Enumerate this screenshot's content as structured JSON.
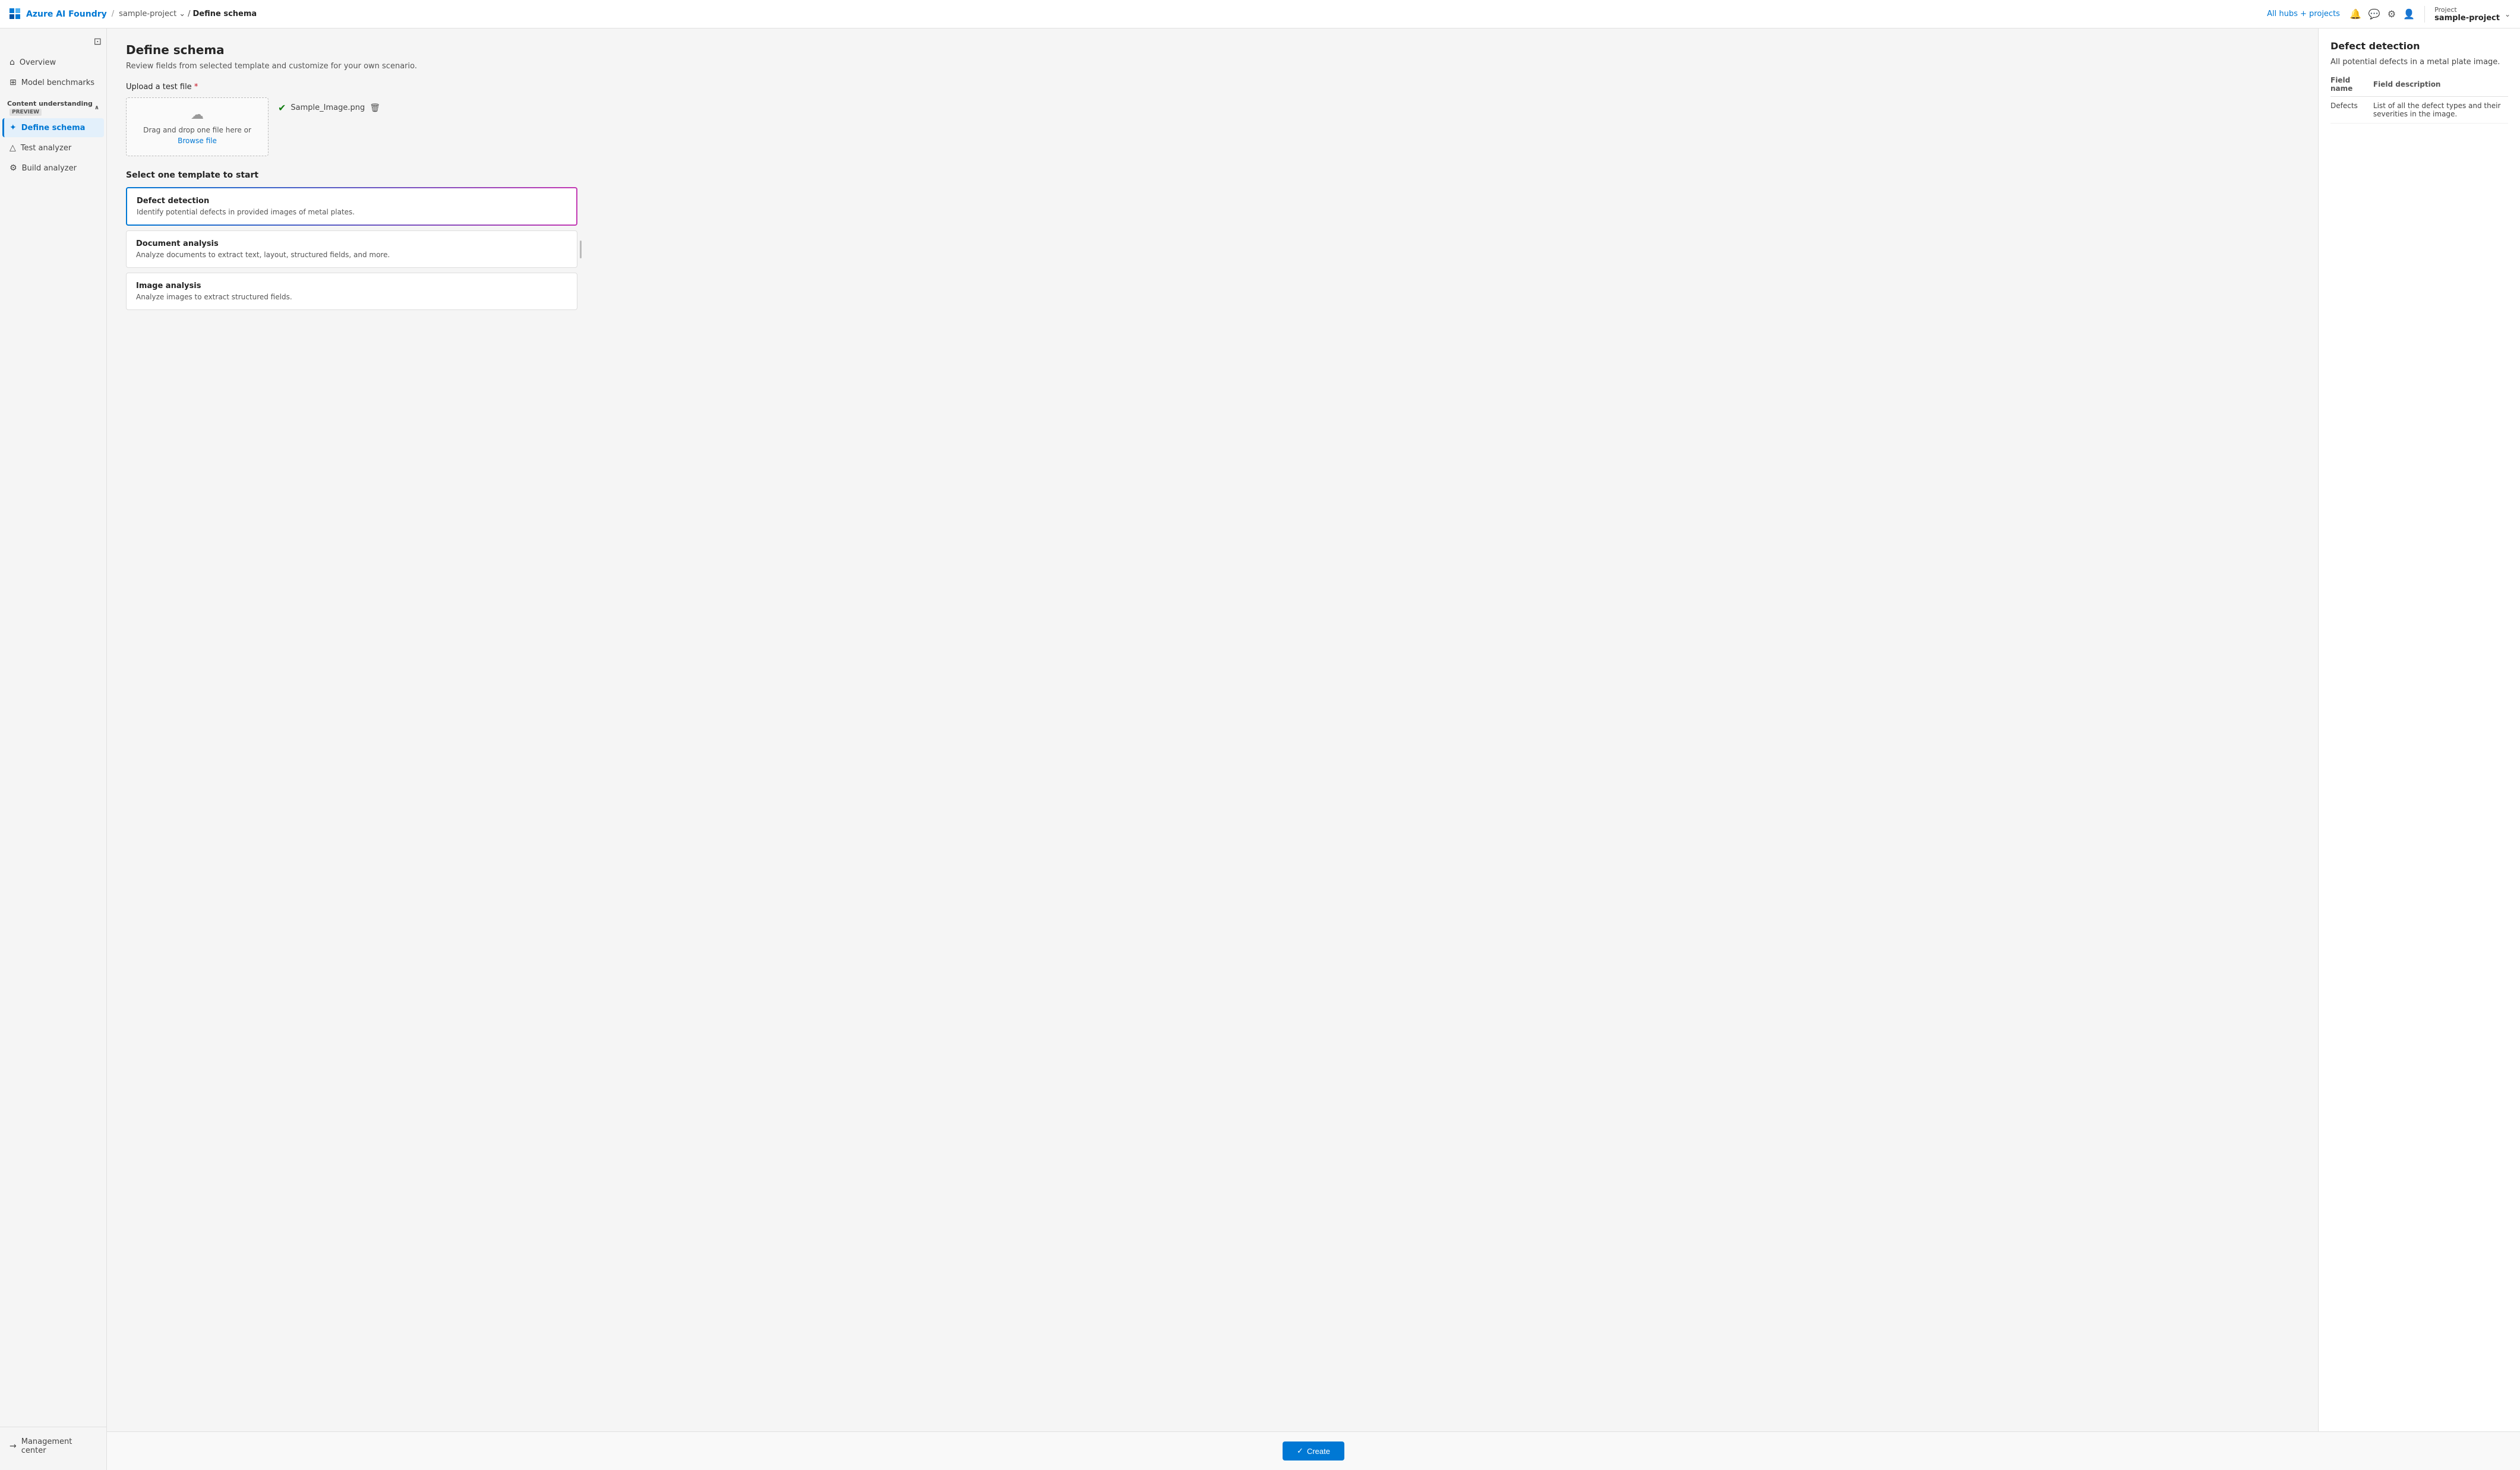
{
  "topnav": {
    "brand": "Azure AI Foundry",
    "breadcrumbs": [
      "sample-project",
      "Define schema"
    ],
    "all_hubs_label": "All hubs + projects",
    "project_label": "Project",
    "project_name": "sample-project"
  },
  "sidebar": {
    "toggle_icon": "⊡",
    "items": [
      {
        "id": "overview",
        "label": "Overview",
        "icon": "⌂"
      },
      {
        "id": "model-benchmarks",
        "label": "Model benchmarks",
        "icon": "⊞"
      }
    ],
    "section": {
      "label": "Content understanding",
      "preview_badge": "PREVIEW"
    },
    "section_items": [
      {
        "id": "define-schema",
        "label": "Define schema",
        "icon": "✦",
        "active": true
      },
      {
        "id": "test-analyzer",
        "label": "Test analyzer",
        "icon": "△"
      },
      {
        "id": "build-analyzer",
        "label": "Build analyzer",
        "icon": "⚙"
      }
    ],
    "bottom_item": {
      "label": "Management center",
      "icon": "→"
    }
  },
  "main": {
    "title": "Define schema",
    "subtitle": "Review fields from selected template and customize for your own scenario.",
    "upload": {
      "label": "Upload a test file",
      "required": true,
      "dropzone": {
        "text": "Drag and drop one file here or",
        "browse": "Browse file"
      },
      "uploaded_file": {
        "name": "Sample_Image.png"
      }
    },
    "template": {
      "label": "Select one template to start",
      "items": [
        {
          "id": "defect-detection",
          "title": "Defect detection",
          "desc": "Identify potential defects in provided images of metal plates.",
          "selected": true
        },
        {
          "id": "document-analysis",
          "title": "Document analysis",
          "desc": "Analyze documents to extract text, layout, structured fields, and more.",
          "selected": false
        },
        {
          "id": "image-analysis",
          "title": "Image analysis",
          "desc": "Analyze images to extract structured fields.",
          "selected": false
        }
      ]
    },
    "footer": {
      "create_button": "Create"
    }
  },
  "panel": {
    "title": "Defect detection",
    "desc": "All potential defects in a metal plate image.",
    "table": {
      "headers": [
        "Field name",
        "Field description"
      ],
      "rows": [
        {
          "field_name": "Defects",
          "field_desc": "List of all the defect types and their severities in the image."
        }
      ]
    }
  }
}
